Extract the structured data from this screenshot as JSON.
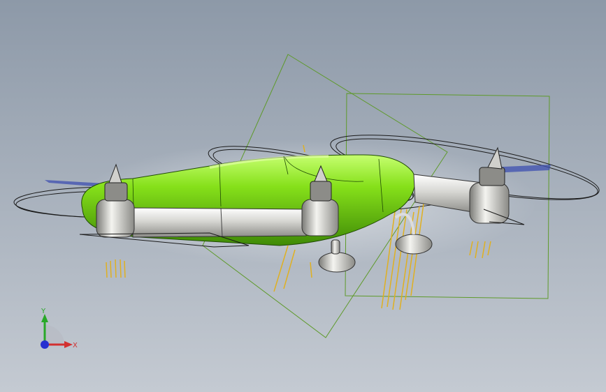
{
  "viewport": {
    "background_top": "#8d99a8",
    "background_bottom": "#c4cad2"
  },
  "model": {
    "body_color": "#7fdc14",
    "arm_color": "#d8d8d4",
    "plane_color": "#5e9a2a",
    "sketch_color": "#e0b020",
    "propeller_color": "#3d4fb0"
  },
  "triad": {
    "x_label": "X",
    "y_label": "Y",
    "x_color": "#d23030",
    "y_color": "#28a828",
    "z_color": "#2830d0"
  }
}
